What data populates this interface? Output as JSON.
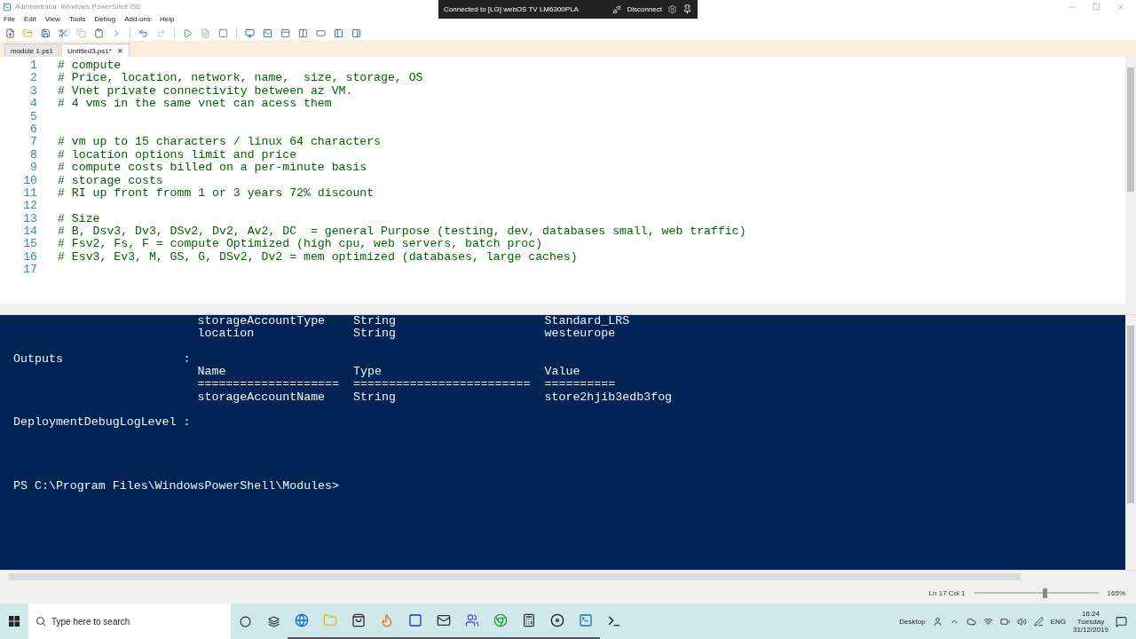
{
  "window": {
    "title": "Administrator: Windows PowerShell ISE"
  },
  "remote_bar": {
    "status": "Connected to [LG] webOS TV LM6300PLA",
    "disconnect": "Disconnect"
  },
  "menu": [
    "File",
    "Edit",
    "View",
    "Tools",
    "Debug",
    "Add-ons",
    "Help"
  ],
  "tabs": [
    {
      "label": "module 1.ps1",
      "selected": false
    },
    {
      "label": "Untitled3.ps1*",
      "selected": true,
      "close": "✕"
    }
  ],
  "editor": {
    "lines": [
      {
        "number": "1",
        "text": "# compute"
      },
      {
        "number": "2",
        "text": "# Price, location, network, name,  size, storage, OS"
      },
      {
        "number": "3",
        "text": "# Vnet private connectivity between az VM."
      },
      {
        "number": "4",
        "text": "# 4 vms in the same vnet can acess them"
      },
      {
        "number": "5"
      },
      {
        "number": "6"
      },
      {
        "number": "7",
        "text": "# vm up to 15 characters / linux 64 characters"
      },
      {
        "number": "8",
        "text": "# location options limit and price"
      },
      {
        "number": "9",
        "text": "# compute costs billed on a per-minute basis"
      },
      {
        "number": "10",
        "text": "# storage costs"
      },
      {
        "number": "11",
        "text": "# RI up front fromm 1 or 3 years 72% discount"
      },
      {
        "number": "12"
      },
      {
        "number": "13",
        "text": "# Size"
      },
      {
        "number": "14",
        "text": "# B, Dsv3, Dv3, DSv2, Dv2, Av2, DC  = general Purpose (testing, dev, databases small, web traffic)"
      },
      {
        "number": "15",
        "text": "# Fsv2, Fs, F = compute Optimized (high cpu, web servers, batch proc)"
      },
      {
        "number": "16",
        "text": "# Esv3, Ev3, M, GS, G, DSv2, Dv2 = mem optimized (databases, large caches)"
      },
      {
        "number": "17"
      }
    ]
  },
  "console": {
    "lines": [
      {
        "kind": "output",
        "text": "                          storageAccountType    String                     Standard_LRS"
      },
      {
        "kind": "output",
        "text": "                          location              String                     westeurope"
      },
      {
        "kind": "blank"
      },
      {
        "kind": "output",
        "text": "Outputs                 :"
      },
      {
        "kind": "output",
        "text": "                          Name                  Type                       Value"
      },
      {
        "kind": "output",
        "text": "                          ====================  =========================  =========="
      },
      {
        "kind": "output",
        "text": "                          storageAccountName    String                     store2hjib3edb3fog"
      },
      {
        "kind": "blank"
      },
      {
        "kind": "output",
        "text": "DeploymentDebugLogLevel :"
      },
      {
        "kind": "blank"
      },
      {
        "kind": "blank"
      },
      {
        "kind": "blank"
      },
      {
        "kind": "blank"
      },
      {
        "kind": "output",
        "text": "PS C:\\Program Files\\WindowsPowerShell\\Modules>"
      }
    ]
  },
  "status_bar": {
    "position": "Ln 17  Col 1",
    "zoom": "165%",
    "level": 0.55
  },
  "taskbar": {
    "search_placeholder": "Type here to search",
    "desktop": "Desktop",
    "language": "ENG",
    "time": "16:24",
    "day": "Tuesday",
    "date": "31/12/2019"
  }
}
